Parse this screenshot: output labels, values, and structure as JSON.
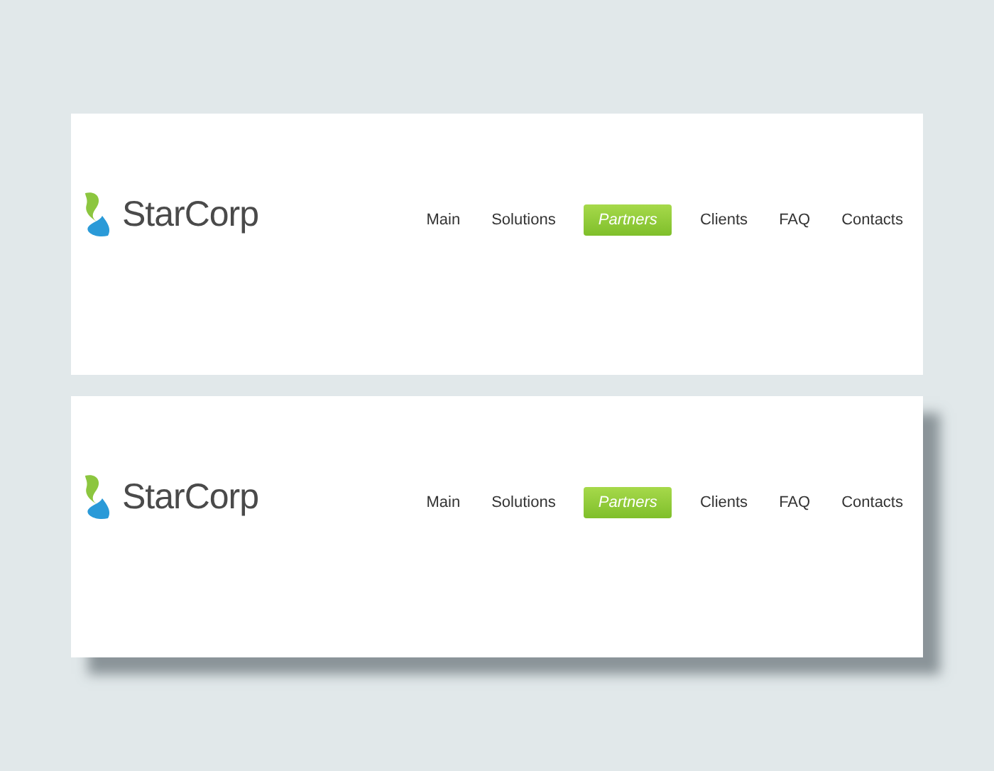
{
  "panels": [
    {
      "shadow": false,
      "logo": "StarCorp",
      "nav": [
        {
          "label": "Main",
          "selected": false
        },
        {
          "label": "Solutions",
          "selected": false
        },
        {
          "label": "Partners",
          "selected": true
        },
        {
          "label": "Clients",
          "selected": false
        },
        {
          "label": "FAQ",
          "selected": false
        },
        {
          "label": "Contacts",
          "selected": false
        }
      ]
    },
    {
      "shadow": true,
      "logo": "StarCorp",
      "nav": [
        {
          "label": "Main",
          "selected": false
        },
        {
          "label": "Solutions",
          "selected": false
        },
        {
          "label": "Partners",
          "selected": true
        },
        {
          "label": "Clients",
          "selected": false
        },
        {
          "label": "FAQ",
          "selected": false
        },
        {
          "label": "Contacts",
          "selected": false
        }
      ]
    }
  ]
}
